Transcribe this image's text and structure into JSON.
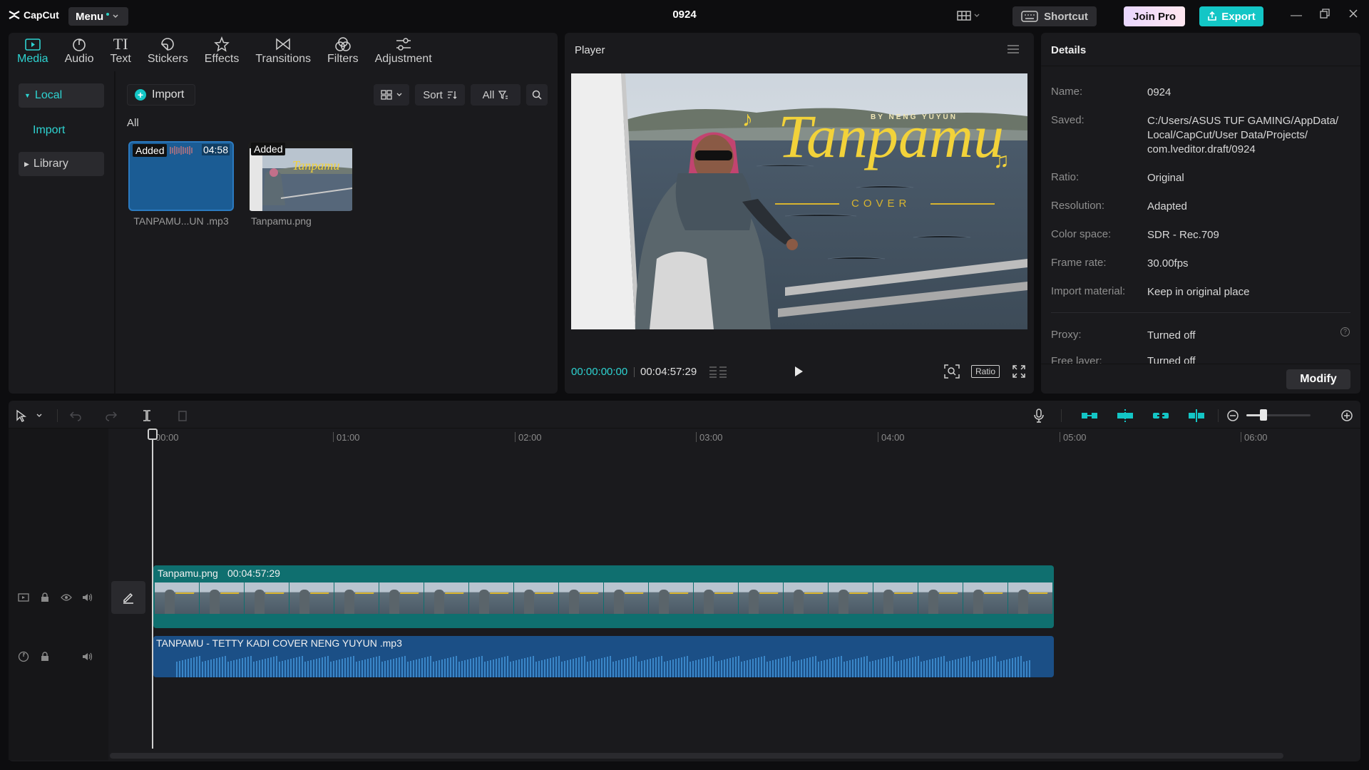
{
  "app": {
    "name": "CapCut",
    "menu_label": "Menu",
    "project_title": "0924"
  },
  "header": {
    "shortcut_label": "Shortcut",
    "join_pro_label": "Join Pro",
    "export_label": "Export"
  },
  "toolbar": {
    "tabs": [
      {
        "label": "Media",
        "icon": "media-icon",
        "active": true
      },
      {
        "label": "Audio",
        "icon": "audio-icon"
      },
      {
        "label": "Text",
        "icon": "text-icon"
      },
      {
        "label": "Stickers",
        "icon": "stickers-icon"
      },
      {
        "label": "Effects",
        "icon": "effects-icon"
      },
      {
        "label": "Transitions",
        "icon": "transitions-icon"
      },
      {
        "label": "Filters",
        "icon": "filters-icon"
      },
      {
        "label": "Adjustment",
        "icon": "adjustment-icon"
      }
    ]
  },
  "media": {
    "sidebar": {
      "local": "Local",
      "import": "Import",
      "library": "Library"
    },
    "import_button": "Import",
    "sort_label": "Sort",
    "all_filter": "All",
    "section_label": "All",
    "items": [
      {
        "tag": "Added",
        "duration": "04:58",
        "caption": "TANPAMU...UN .mp3",
        "type": "audio"
      },
      {
        "tag": "Added",
        "caption": "Tanpamu.png",
        "type": "image",
        "overlay_title": "Tanpamu"
      }
    ]
  },
  "player": {
    "title": "Player",
    "current_time": "00:00:00:00",
    "total_time": "00:04:57:29",
    "ratio_label": "Ratio",
    "overlay": {
      "by_line": "BY NENG YUYUN",
      "title": "Tanpamu",
      "subtitle": "COVER"
    }
  },
  "details": {
    "title": "Details",
    "rows": [
      {
        "key": "Name:",
        "value": "0924"
      },
      {
        "key": "Saved:",
        "value": "C:/Users/ASUS TUF GAMING/AppData/ Local/CapCut/User Data/Projects/ com.lveditor.draft/0924"
      },
      {
        "key": "Ratio:",
        "value": "Original"
      },
      {
        "key": "Resolution:",
        "value": "Adapted"
      },
      {
        "key": "Color space:",
        "value": "SDR - Rec.709"
      },
      {
        "key": "Frame rate:",
        "value": "30.00fps"
      },
      {
        "key": "Import material:",
        "value": "Keep in original place"
      },
      {
        "key": "Proxy:",
        "value": "Turned off"
      },
      {
        "key": "Free layer:",
        "value": "Turned off"
      }
    ],
    "modify_label": "Modify"
  },
  "timeline": {
    "ruler": [
      "00:00",
      "01:00",
      "02:00",
      "03:00",
      "04:00",
      "05:00",
      "06:00"
    ],
    "video_clip": {
      "name": "Tanpamu.png",
      "duration": "00:04:57:29"
    },
    "audio_clip": {
      "name": "TANPAMU - TETTY KADI COVER NENG YUYUN .mp3"
    }
  },
  "colors": {
    "accent": "#13c6c6",
    "video_track": "#0f6f6f",
    "audio_track": "#1b4f86",
    "overlay_gold": "#f2d23a"
  }
}
